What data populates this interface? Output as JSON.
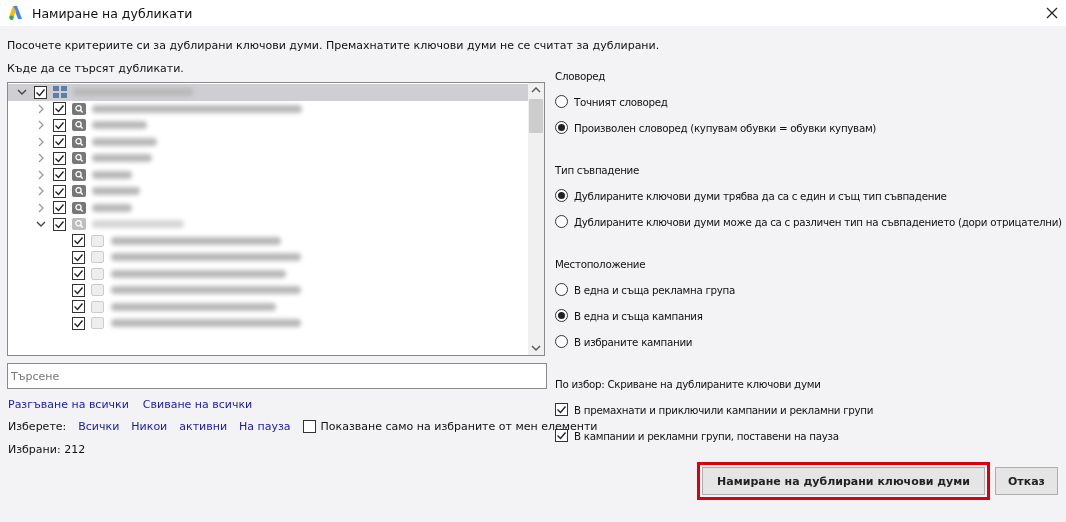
{
  "window": {
    "title": "Намиране на дубликати"
  },
  "instructions": "Посочете критериите си за дублирани ключови думи. Премахнатите ключови думи не се считат за дублирани.",
  "where_label": "Къде да се търсят дубликати.",
  "tree": {
    "root": {
      "kind": "account",
      "checked": true,
      "expanded": true,
      "selected": true,
      "children": [
        {
          "kind": "campaign",
          "checked": true,
          "expanded": false,
          "paused": false
        },
        {
          "kind": "campaign",
          "checked": true,
          "expanded": false,
          "paused": false
        },
        {
          "kind": "campaign",
          "checked": true,
          "expanded": false,
          "paused": false
        },
        {
          "kind": "campaign",
          "checked": true,
          "expanded": false,
          "paused": false
        },
        {
          "kind": "campaign",
          "checked": true,
          "expanded": false,
          "paused": false
        },
        {
          "kind": "campaign",
          "checked": true,
          "expanded": false,
          "paused": false
        },
        {
          "kind": "campaign",
          "checked": true,
          "expanded": false,
          "paused": false
        },
        {
          "kind": "campaign",
          "checked": true,
          "expanded": true,
          "paused": true,
          "children": [
            {
              "kind": "adgroup",
              "checked": true
            },
            {
              "kind": "adgroup",
              "checked": true
            },
            {
              "kind": "adgroup",
              "checked": true
            },
            {
              "kind": "adgroup",
              "checked": true
            },
            {
              "kind": "adgroup",
              "checked": true
            },
            {
              "kind": "adgroup",
              "checked": true
            }
          ]
        }
      ]
    }
  },
  "search": {
    "placeholder": "Търсене"
  },
  "links": [
    "Разгъване на всички",
    "Свиване на всички"
  ],
  "select": {
    "label": "Изберете:",
    "links": [
      "Всички",
      "Никои",
      "активни",
      "На пауза"
    ],
    "show_selected": {
      "label": "Показване само на избраните от мен елементи",
      "checked": false
    }
  },
  "selected_count": "Избрани: 212",
  "groups": [
    {
      "title": "Словоред",
      "options": [
        {
          "label": "Точният словоред",
          "selected": false
        },
        {
          "label": "Произволен словоред (купувам обувки = обувки купувам)",
          "selected": true
        }
      ]
    },
    {
      "title": "Тип съвпадение",
      "options": [
        {
          "label": "Дублираните ключови думи трябва да са с един и същ тип съвпадение",
          "selected": true
        },
        {
          "label": "Дублираните ключови думи може да са с различен тип на съвпадението (дори отрицателни)",
          "selected": false
        }
      ]
    },
    {
      "title": "Местоположение",
      "options": [
        {
          "label": "В една и съща рекламна група",
          "selected": false
        },
        {
          "label": "В една и съща кампания",
          "selected": true
        },
        {
          "label": "В избраните кампании",
          "selected": false
        }
      ]
    }
  ],
  "hide": {
    "title": "По избор: Скриване на дублираните ключови думи",
    "options": [
      {
        "label": "В премахнати и приключили кампании и рекламни групи",
        "checked": true
      },
      {
        "label": "В кампании и рекламни групи, поставени на пауза",
        "checked": true
      }
    ]
  },
  "buttons": [
    {
      "label": "Намиране на дублирани ключови думи",
      "kind": "find",
      "highlighted": true
    },
    {
      "label": "Отказ",
      "kind": "cancel",
      "highlighted": false
    }
  ]
}
